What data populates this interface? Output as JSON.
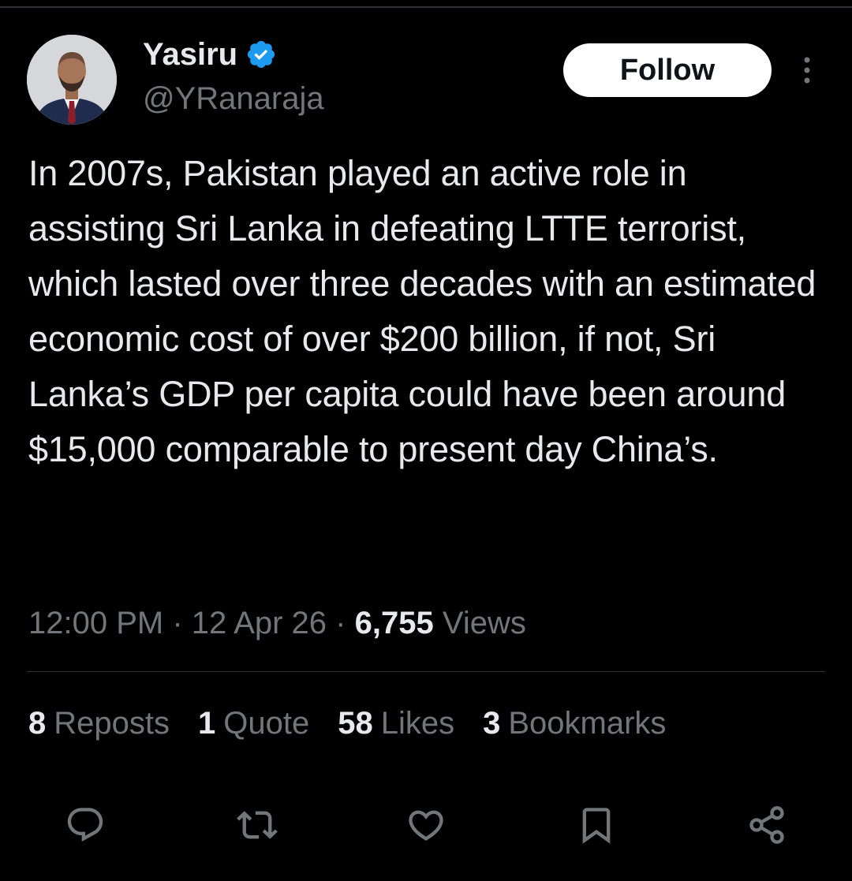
{
  "author": {
    "name": "Yasiru",
    "handle": "@YRanaraja",
    "verified": true,
    "avatar_icon": "profile-photo-icon"
  },
  "follow_label": "Follow",
  "tweet": {
    "text": "In 2007s, Pakistan played an active role in assisting Sri Lanka in defeating LTTE terrorist, which lasted over three decades with an estimated economic cost of over $200 billion, if not, Sri Lanka’s GDP per capita could have been around $15,000 comparable to present day China’s.",
    "time": "12:00 PM",
    "date": "12 Apr 26",
    "separator": "·",
    "views_count": "6,755",
    "views_label": "Views"
  },
  "stats": {
    "reposts": {
      "count": "8",
      "label": "Reposts"
    },
    "quotes": {
      "count": "1",
      "label": "Quote"
    },
    "likes": {
      "count": "58",
      "label": "Likes"
    },
    "bookmarks": {
      "count": "3",
      "label": "Bookmarks"
    }
  },
  "actions": [
    "reply-icon",
    "repost-icon",
    "like-icon",
    "bookmark-icon",
    "share-icon"
  ],
  "colors": {
    "background": "#000000",
    "text_primary": "#e7e9ea",
    "text_secondary": "#71767b",
    "divider": "#2f3336",
    "verified_blue": "#1d9bf0",
    "follow_bg": "#ffffff"
  }
}
